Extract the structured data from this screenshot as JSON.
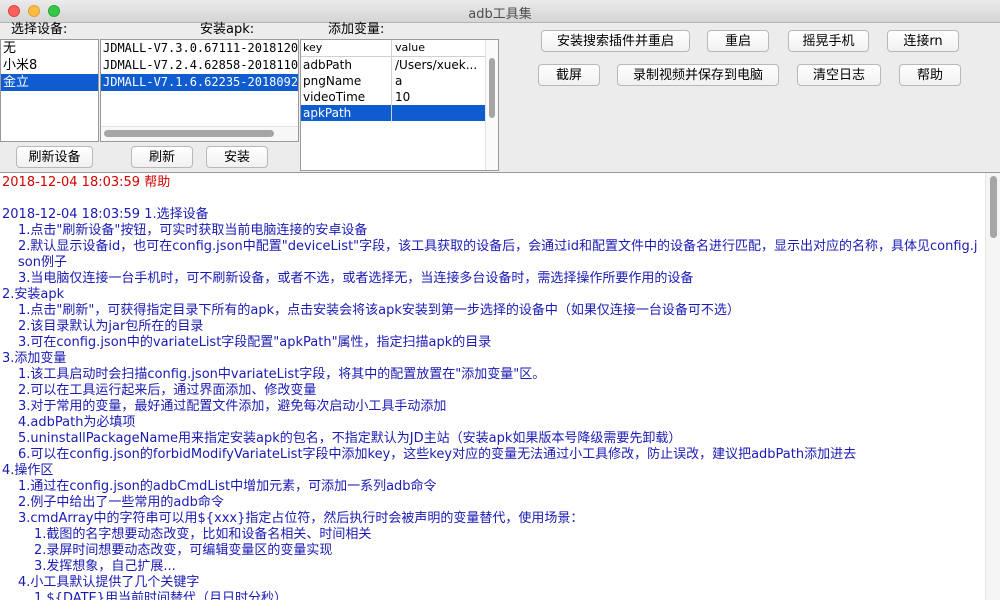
{
  "window": {
    "title": "adb工具集"
  },
  "devices": {
    "label": "选择设备:",
    "items": [
      "无",
      "小米8",
      "金立"
    ],
    "selected_index": 2,
    "refresh_label": "刷新设备"
  },
  "apks": {
    "label": "安装apk:",
    "items": [
      "JDMALL-V7.3.0.67111-2018120",
      "JDMALL-V7.2.4.62858-2018110",
      "JDMALL-V7.1.6.62235-2018092"
    ],
    "selected_index": 2,
    "refresh_label": "刷新",
    "install_label": "安装"
  },
  "variables": {
    "label": "添加变量:",
    "columns": [
      "key",
      "value"
    ],
    "rows": [
      {
        "key": "adbPath",
        "value": "/Users/xuek..."
      },
      {
        "key": "pngName",
        "value": "a"
      },
      {
        "key": "videoTime",
        "value": "10"
      },
      {
        "key": "apkPath",
        "value": ""
      }
    ],
    "selected_index": 3
  },
  "actions": {
    "install_search_plugin": "安装搜索插件并重启",
    "restart": "重启",
    "shake_phone": "摇晃手机",
    "connect_rn": "连接rn",
    "screenshot": "截屏",
    "record_video": "录制视频并保存到电脑",
    "clear_log": "清空日志",
    "help": "帮助"
  },
  "log": {
    "lines": [
      {
        "text": "2018-12-04 18:03:59 帮助",
        "style": "red",
        "indent": 0
      },
      {
        "text": "",
        "style": "blank",
        "indent": 0
      },
      {
        "text": "2018-12-04 18:03:59 1.选择设备",
        "style": "normal",
        "indent": 0
      },
      {
        "text": "1.点击\"刷新设备\"按钮，可实时获取当前电脑连接的安卓设备",
        "style": "normal",
        "indent": 1
      },
      {
        "text": "2.默认显示设备id，也可在config.json中配置\"deviceList\"字段，该工具获取的设备后，会通过id和配置文件中的设备名进行匹配，显示出对应的名称，具体见config.json例子",
        "style": "normal",
        "indent": 1
      },
      {
        "text": "3.当电脑仅连接一台手机时，可不刷新设备，或者不选，或者选择无，当连接多台设备时，需选择操作所要作用的设备",
        "style": "normal",
        "indent": 1
      },
      {
        "text": "2.安装apk",
        "style": "normal",
        "indent": 0
      },
      {
        "text": "1.点击\"刷新\"，可获得指定目录下所有的apk，点击安装会将该apk安装到第一步选择的设备中（如果仅连接一台设备可不选）",
        "style": "normal",
        "indent": 1
      },
      {
        "text": "2.该目录默认为jar包所在的目录",
        "style": "normal",
        "indent": 1
      },
      {
        "text": "3.可在config.json中的variateList字段配置\"apkPath\"属性，指定扫描apk的目录",
        "style": "normal",
        "indent": 1
      },
      {
        "text": "3.添加变量",
        "style": "normal",
        "indent": 0
      },
      {
        "text": "1.该工具启动时会扫描config.json中variateList字段，将其中的配置放置在\"添加变量\"区。",
        "style": "normal",
        "indent": 1
      },
      {
        "text": "2.可以在工具运行起来后，通过界面添加、修改变量",
        "style": "normal",
        "indent": 1
      },
      {
        "text": "3.对于常用的变量，最好通过配置文件添加，避免每次启动小工具手动添加",
        "style": "normal",
        "indent": 1
      },
      {
        "text": "4.adbPath为必填项",
        "style": "normal",
        "indent": 1
      },
      {
        "text": "5.uninstallPackageName用来指定安装apk的包名，不指定默认为JD主站（安装apk如果版本号降级需要先卸载）",
        "style": "normal",
        "indent": 1
      },
      {
        "text": "6.可以在config.json的forbidModifyVariateList字段中添加key，这些key对应的变量无法通过小工具修改，防止误改，建议把adbPath添加进去",
        "style": "normal",
        "indent": 1
      },
      {
        "text": "4.操作区",
        "style": "normal",
        "indent": 0
      },
      {
        "text": "1.通过在config.json的adbCmdList中增加元素，可添加一系列adb命令",
        "style": "normal",
        "indent": 1
      },
      {
        "text": "2.例子中给出了一些常用的adb命令",
        "style": "normal",
        "indent": 1
      },
      {
        "text": "3.cmdArray中的字符串可以用${xxx}指定占位符，然后执行时会被声明的变量替代，使用场景：",
        "style": "normal",
        "indent": 1
      },
      {
        "text": "1.截图的名字想要动态改变，比如和设备名相关、时间相关",
        "style": "normal",
        "indent": 2
      },
      {
        "text": "2.录屏时间想要动态改变，可编辑变量区的变量实现",
        "style": "normal",
        "indent": 2
      },
      {
        "text": "3.发挥想象，自己扩展...",
        "style": "normal",
        "indent": 2
      },
      {
        "text": "4.小工具默认提供了几个关键字",
        "style": "normal",
        "indent": 1
      },
      {
        "text": "1.${DATE}用当前时间替代（月日时分秒）",
        "style": "normal",
        "indent": 2
      }
    ]
  }
}
